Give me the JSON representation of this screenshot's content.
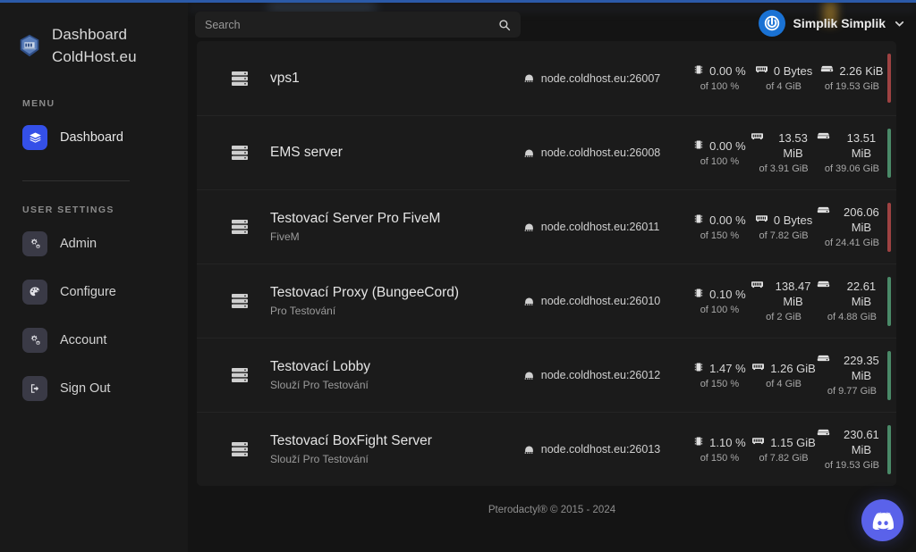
{
  "sidebar": {
    "brand": {
      "line1": "Dashboard",
      "line2": "ColdHost.eu",
      "logo_icon": "coldhost-emblem-icon"
    },
    "menu_label": "MENU",
    "menu_items": [
      {
        "label": "Dashboard",
        "icon": "layers-icon"
      }
    ],
    "user_settings_label": "USER SETTINGS",
    "user_items": [
      {
        "label": "Admin",
        "icon": "cogs-icon"
      },
      {
        "label": "Configure",
        "icon": "palette-icon"
      },
      {
        "label": "Account",
        "icon": "cogs-icon"
      },
      {
        "label": "Sign Out",
        "icon": "sign-out-icon"
      }
    ]
  },
  "header": {
    "search": {
      "placeholder": "Search",
      "value": "",
      "icon": "search-icon"
    },
    "user": {
      "name": "Simplik Simplik",
      "avatar_icon": "power-circle-icon",
      "caret": "⌄"
    }
  },
  "servers": [
    {
      "name": "vps1",
      "description": "",
      "node": "node.coldhost.eu:26007",
      "cpu": {
        "value": "0.00 %",
        "limit": "of 100 %"
      },
      "memory": {
        "value": "0 Bytes",
        "limit": "of 4 GiB"
      },
      "disk": {
        "value": "2.26 KiB",
        "limit": "of 19.53 GiB"
      },
      "status": "offline",
      "status_color": "#9e4242"
    },
    {
      "name": "EMS server",
      "description": "",
      "node": "node.coldhost.eu:26008",
      "cpu": {
        "value": "0.00 %",
        "limit": "of 100 %"
      },
      "memory": {
        "value": "13.53 MiB",
        "limit": "of 3.91 GiB"
      },
      "disk": {
        "value": "13.51 MiB",
        "limit": "of 39.06 GiB"
      },
      "status": "online",
      "status_color": "#4a8a68"
    },
    {
      "name": "Testovací Server Pro FiveM",
      "description": "FiveM",
      "node": "node.coldhost.eu:26011",
      "cpu": {
        "value": "0.00 %",
        "limit": "of 150 %"
      },
      "memory": {
        "value": "0 Bytes",
        "limit": "of 7.82 GiB"
      },
      "disk": {
        "value": "206.06 MiB",
        "limit": "of 24.41 GiB"
      },
      "status": "offline",
      "status_color": "#9e4242"
    },
    {
      "name": "Testovací Proxy (BungeeCord)",
      "description": "Pro Testování",
      "node": "node.coldhost.eu:26010",
      "cpu": {
        "value": "0.10 %",
        "limit": "of 100 %"
      },
      "memory": {
        "value": "138.47 MiB",
        "limit": "of 2 GiB"
      },
      "disk": {
        "value": "22.61 MiB",
        "limit": "of 4.88 GiB"
      },
      "status": "online",
      "status_color": "#4a8a68"
    },
    {
      "name": "Testovací Lobby",
      "description": "Slouží Pro Testování",
      "node": "node.coldhost.eu:26012",
      "cpu": {
        "value": "1.47 %",
        "limit": "of 150 %"
      },
      "memory": {
        "value": "1.26 GiB",
        "limit": "of 4 GiB"
      },
      "disk": {
        "value": "229.35 MiB",
        "limit": "of 9.77 GiB"
      },
      "status": "online",
      "status_color": "#4a8a68"
    },
    {
      "name": "Testovací BoxFight Server",
      "description": "Slouží Pro Testování",
      "node": "node.coldhost.eu:26013",
      "cpu": {
        "value": "1.10 %",
        "limit": "of 150 %"
      },
      "memory": {
        "value": "1.15 GiB",
        "limit": "of 7.82 GiB"
      },
      "disk": {
        "value": "230.61 MiB",
        "limit": "of 19.53 GiB"
      },
      "status": "online",
      "status_color": "#4a8a68"
    }
  ],
  "icons": {
    "server_rack": "server-rack-icon",
    "node": "network-node-icon",
    "cpu": "microchip-icon",
    "memory": "memory-stick-icon",
    "disk": "hard-drive-icon"
  },
  "footer": {
    "text": "Pterodactyl® © 2015 - 2024"
  },
  "widgets": {
    "discord": {
      "icon": "discord-icon",
      "color": "#5a62ea"
    }
  },
  "colors": {
    "accent": "#3450e8",
    "online": "#4a8a68",
    "offline": "#9e4242",
    "top_accent": "#2b5aa8"
  }
}
